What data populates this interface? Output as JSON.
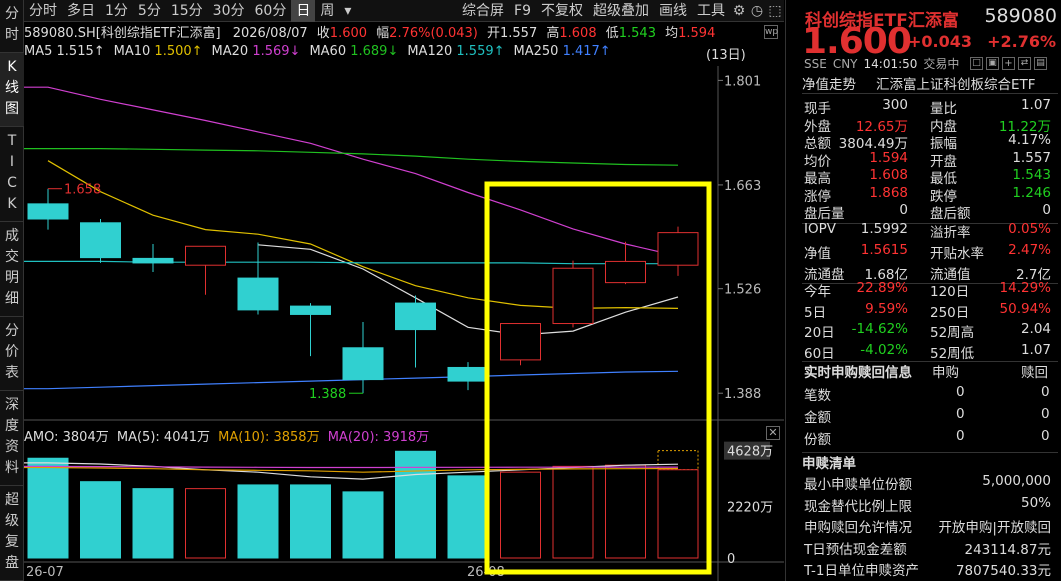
{
  "vtabs": [
    {
      "label": "分时",
      "chars": [
        "分",
        "时"
      ]
    },
    {
      "label": "K线图",
      "chars": [
        "K",
        "线",
        "图"
      ]
    },
    {
      "label": "TICK",
      "chars": [
        "T",
        "I",
        "C",
        "K"
      ]
    },
    {
      "label": "成交明细",
      "chars": [
        "成",
        "交",
        "明",
        "细"
      ]
    },
    {
      "label": "分价表",
      "chars": [
        "分",
        "价",
        "表"
      ]
    },
    {
      "label": "深度资料",
      "chars": [
        "深",
        "度",
        "资",
        "料"
      ]
    },
    {
      "label": "超级复盘",
      "chars": [
        "超",
        "级",
        "复",
        "盘"
      ]
    }
  ],
  "toolbar": {
    "periods": [
      "分时",
      "多日",
      "1分",
      "5分",
      "15分",
      "30分",
      "60分",
      "日",
      "周"
    ],
    "active_period": "日",
    "more_icon": "▾",
    "right_items": [
      "综合屏",
      "F9",
      "不复权",
      "超级叠加",
      "画线",
      "工具"
    ]
  },
  "chart_header": {
    "title": "589080.SH[科创综指ETF汇添富]",
    "date": "2026/08/07",
    "close_label": "收",
    "close_value": "1.600",
    "range_label": "幅",
    "range_value": "2.76%(0.043)",
    "open_label": "开",
    "open_value": "1.557",
    "high_label": "高",
    "high_value": "1.608",
    "low_label": "低",
    "low_value": "1.543",
    "avg_label": "均",
    "avg_value": "1.594",
    "day_count": "(13日)",
    "ma_items": [
      {
        "name": "MA5",
        "value": "1.515↑",
        "color": "#dddddd"
      },
      {
        "name": "MA10",
        "value": "1.500↑",
        "color": "#e0c000"
      },
      {
        "name": "MA20",
        "value": "1.569↓",
        "color": "#d040d0"
      },
      {
        "name": "MA60",
        "value": "1.689↓",
        "color": "#20c020"
      },
      {
        "name": "MA120",
        "value": "1.559↑",
        "color": "#20c0c0"
      },
      {
        "name": "MA250",
        "value": "1.417↑",
        "color": "#4080ff"
      }
    ]
  },
  "volume_header": {
    "amo_label": "AMO:",
    "amo_value": "3804万",
    "ma5_label": "MA(5):",
    "ma5_value": "4041万",
    "ma10_label": "MA(10):",
    "ma10_value": "3858万",
    "ma20_label": "MA(20):",
    "ma20_value": "3918万"
  },
  "price_axis": [
    "1.801",
    "1.663",
    "1.526",
    "1.388"
  ],
  "volume_axis": [
    "4628万",
    "2220万",
    "0"
  ],
  "x_labels": [
    "26-07",
    "26-08"
  ],
  "chart_data": {
    "type": "candlestick",
    "candles": [
      {
        "o": 1.638,
        "h": 1.658,
        "l": 1.604,
        "c": 1.618,
        "up": false
      },
      {
        "o": 1.613,
        "h": 1.618,
        "l": 1.56,
        "c": 1.567,
        "up": false
      },
      {
        "o": 1.566,
        "h": 1.585,
        "l": 1.548,
        "c": 1.56,
        "up": false
      },
      {
        "o": 1.557,
        "h": 1.578,
        "l": 1.518,
        "c": 1.582,
        "up": true
      },
      {
        "o": 1.54,
        "h": 1.587,
        "l": 1.492,
        "c": 1.498,
        "up": false
      },
      {
        "o": 1.503,
        "h": 1.507,
        "l": 1.437,
        "c": 1.492,
        "up": false
      },
      {
        "o": 1.448,
        "h": 1.482,
        "l": 1.388,
        "c": 1.406,
        "up": false
      },
      {
        "o": 1.507,
        "h": 1.517,
        "l": 1.422,
        "c": 1.472,
        "up": false
      },
      {
        "o": 1.422,
        "h": 1.429,
        "l": 1.392,
        "c": 1.404,
        "up": false
      },
      {
        "o": 1.432,
        "h": 1.48,
        "l": 1.425,
        "c": 1.48,
        "up": true
      },
      {
        "o": 1.48,
        "h": 1.563,
        "l": 1.475,
        "c": 1.553,
        "up": true
      },
      {
        "o": 1.534,
        "h": 1.588,
        "l": 1.532,
        "c": 1.562,
        "up": true
      },
      {
        "o": 1.557,
        "h": 1.608,
        "l": 1.543,
        "c": 1.6,
        "up": true
      }
    ],
    "high_label": "1.658",
    "low_label": "1.388",
    "ma_lines": {
      "ma5": [
        null,
        null,
        null,
        null,
        1.584,
        1.578,
        1.552,
        1.514,
        1.475,
        1.465,
        1.47,
        1.495,
        1.515
      ],
      "ma10": [
        1.695,
        1.654,
        1.623,
        1.604,
        1.598,
        1.585,
        1.555,
        1.53,
        1.514,
        1.504,
        1.5,
        1.501,
        1.5
      ],
      "ma20": [
        1.792,
        1.776,
        1.762,
        1.748,
        1.733,
        1.718,
        1.697,
        1.678,
        1.653,
        1.63,
        1.605,
        1.585,
        1.569
      ],
      "ma60": [
        1.711,
        1.711,
        1.71,
        1.709,
        1.708,
        1.706,
        1.704,
        1.701,
        1.697,
        1.694,
        1.692,
        1.69,
        1.689
      ],
      "ma120": [
        1.562,
        1.562,
        1.561,
        1.561,
        1.561,
        1.561,
        1.56,
        1.56,
        1.56,
        1.56,
        1.559,
        1.559,
        1.559
      ],
      "ma250": [
        1.394,
        1.396,
        1.398,
        1.4,
        1.402,
        1.404,
        1.406,
        1.408,
        1.41,
        1.412,
        1.414,
        1.416,
        1.417
      ]
    },
    "volumes": [
      4300,
      3290,
      2990,
      2990,
      3150,
      3150,
      2850,
      4600,
      3540,
      3700,
      3950,
      4000,
      3804
    ],
    "vol_ma5": [
      4100,
      4050,
      3950,
      3800,
      3700,
      3500,
      3400,
      3600,
      3700,
      3800,
      3900,
      4000,
      4041
    ],
    "vol_ma10": [
      3900,
      3880,
      3850,
      3800,
      3780,
      3760,
      3700,
      3750,
      3800,
      3820,
      3840,
      3850,
      3858
    ],
    "vol_ma20": [
      3950,
      3940,
      3930,
      3920,
      3910,
      3900,
      3900,
      3905,
      3910,
      3912,
      3915,
      3916,
      3918
    ],
    "price_range": [
      1.35,
      1.82
    ],
    "volume_range": [
      0,
      5000
    ]
  },
  "quote": {
    "name": "科创综指ETF汇添富",
    "code": "589080",
    "price": "1.600",
    "change": "+0.043",
    "change_pct": "+2.76%",
    "exchange": "SSE",
    "currency": "CNY",
    "time": "14:01:50",
    "status": "交易中",
    "tab_label": "净值走势",
    "tab_name": "汇添富上证科创板综合ETF",
    "rows1": [
      {
        "l1": "现手",
        "v1": "300",
        "c1": "white",
        "l2": "量比",
        "v2": "1.07",
        "c2": "white"
      },
      {
        "l1": "外盘",
        "v1": "12.65万",
        "c1": "red",
        "l2": "内盘",
        "v2": "11.22万",
        "c2": "green"
      },
      {
        "l1": "总额",
        "v1": "3804.49万",
        "c1": "white",
        "l2": "振幅",
        "v2": "4.17%",
        "c2": "white"
      },
      {
        "l1": "均价",
        "v1": "1.594",
        "c1": "red",
        "l2": "开盘",
        "v2": "1.557",
        "c2": "white"
      },
      {
        "l1": "最高",
        "v1": "1.608",
        "c1": "red",
        "l2": "最低",
        "v2": "1.543",
        "c2": "green"
      },
      {
        "l1": "涨停",
        "v1": "1.868",
        "c1": "red",
        "l2": "跌停",
        "v2": "1.246",
        "c2": "green"
      },
      {
        "l1": "盘后量",
        "v1": "0",
        "c1": "white",
        "l2": "盘后额",
        "v2": "0",
        "c2": "white"
      }
    ],
    "rows2": [
      {
        "l1": "IOPV",
        "v1": "1.5992",
        "c1": "white",
        "l2": "溢折率",
        "v2": "0.05%",
        "c2": "red"
      },
      {
        "l1": "净值",
        "v1": "1.5615",
        "c1": "red",
        "l2": "开贴水率",
        "v2": "2.47%",
        "c2": "red"
      },
      {
        "l1": "流通盘",
        "v1": "1.68亿",
        "c1": "white",
        "l2": "流通值",
        "v2": "2.7亿",
        "c2": "white"
      }
    ],
    "rows3": [
      {
        "l1": "今年",
        "v1": "22.89%",
        "c1": "red",
        "l2": "120日",
        "v2": "14.29%",
        "c2": "red"
      },
      {
        "l1": "5日",
        "v1": "9.59%",
        "c1": "red",
        "l2": "250日",
        "v2": "50.94%",
        "c2": "red"
      },
      {
        "l1": "20日",
        "v1": "-14.62%",
        "c1": "green",
        "l2": "52周高",
        "v2": "2.04",
        "c2": "white"
      },
      {
        "l1": "60日",
        "v1": "-4.02%",
        "c1": "green",
        "l2": "52周低",
        "v2": "1.07",
        "c2": "white"
      }
    ],
    "realtime": {
      "title": "实时申购赎回信息",
      "col1": "申购",
      "col2": "赎回",
      "rows": [
        {
          "label": "笔数",
          "v1": "0",
          "v2": "0"
        },
        {
          "label": "金额",
          "v1": "0",
          "v2": "0"
        },
        {
          "label": "份额",
          "v1": "0",
          "v2": "0"
        }
      ]
    },
    "redeem": {
      "title": "申赎清单",
      "rows": [
        {
          "label": "最小申赎单位份额",
          "value": "5,000,000"
        },
        {
          "label": "现金替代比例上限",
          "value": "50%"
        },
        {
          "label": "申购赎回允许情况",
          "value": "开放申购|开放赎回"
        },
        {
          "label": "T日预估现金差额",
          "value": "243114.87元"
        },
        {
          "label": "T-1日单位申赎资产",
          "value": "7807540.33元"
        }
      ]
    }
  },
  "colors": {
    "up": "#e03030",
    "down": "#30d0d0",
    "highlight_box": "#ffff00"
  }
}
